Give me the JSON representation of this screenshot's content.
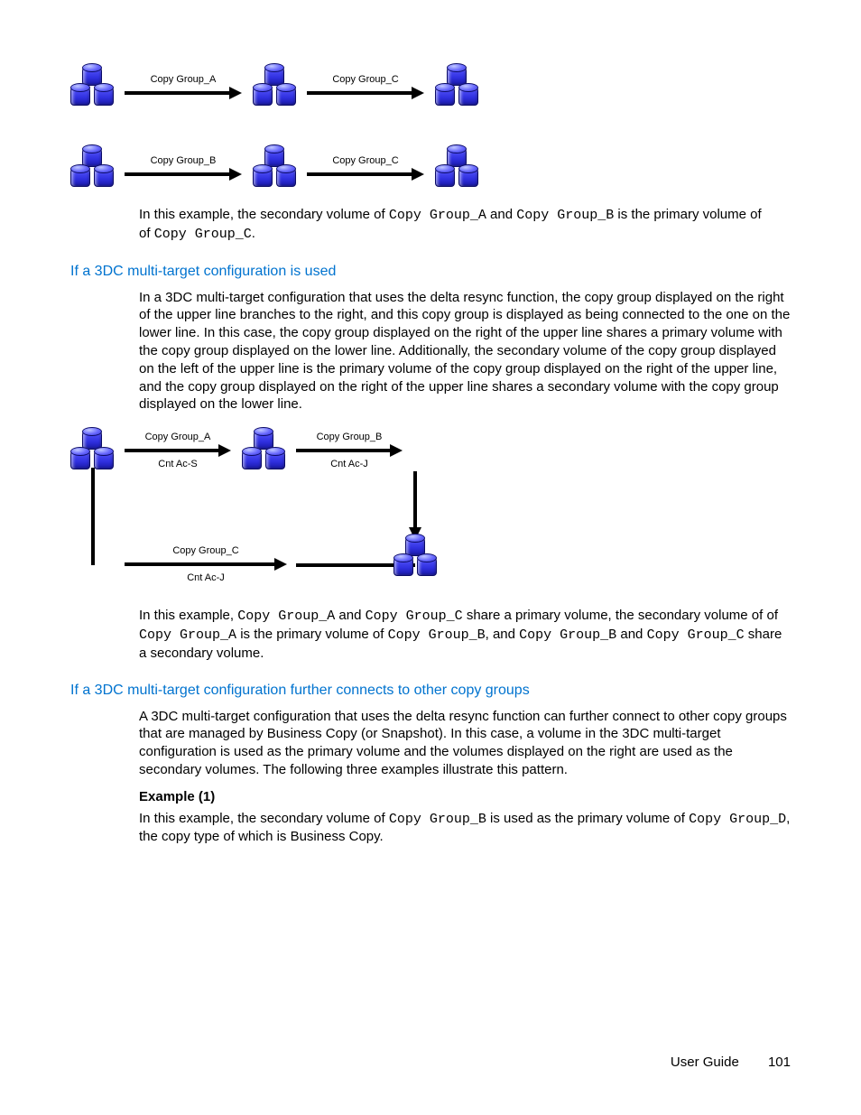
{
  "diagram1": {
    "row1": {
      "a_label": "Copy Group_A",
      "b_label": "Copy Group_C"
    },
    "row2": {
      "a_label": "Copy Group_B",
      "b_label": "Copy Group_C"
    }
  },
  "para1_a": "In this example, the secondary volume of ",
  "para1_ref1": "Copy Group_A",
  "para1_b": " and ",
  "para1_ref2": "Copy Group_B",
  "para1_c": " is the primary volume of ",
  "para1_ref3": "Copy Group_C",
  "para1_d": ".",
  "h_3dc": "If a 3DC multi-target configuration is used",
  "para2": "In a 3DC multi-target configuration that uses the delta resync function, the copy group displayed on the right of the upper line branches to the right, and this copy group is displayed as being connected to the one on the lower line. In this case, the copy group displayed on the right of the upper line shares a primary volume with the copy group displayed on the lower line. Additionally, the secondary volume of the copy group displayed on the left of the upper line is the primary volume of the copy group displayed on the right of the upper line, and the copy group displayed on the right of the upper line shares a secondary volume with the copy group displayed on the lower line.",
  "diagram2": {
    "top_a_label": "Copy Group_A",
    "top_a_sub": "Cnt Ac-S",
    "top_b_label": "Copy Group_B",
    "top_b_sub": "Cnt Ac-J",
    "bot_label": "Copy Group_C",
    "bot_sub": "Cnt Ac-J"
  },
  "para3_a": "In this example, ",
  "para3_ref1": "Copy Group_A",
  "para3_b": " and ",
  "para3_ref2": "Copy Group_C",
  "para3_c": " share a primary volume, the secondary volume of ",
  "para3_ref3": "Copy Group_A",
  "para3_d": " is the primary volume of ",
  "para3_ref4": "Copy Group_B",
  "para3_e": ", and ",
  "para3_ref5": "Copy Group_B",
  "para3_f": " and ",
  "para3_ref6": "Copy Group_C",
  "para3_g": " share a secondary volume.",
  "h_3dc2": "If a 3DC multi-target configuration further connects to other copy groups",
  "para4": "A 3DC multi-target configuration that uses the delta resync function can further connect to other copy groups that are managed by Business Copy (or Snapshot). In this case, a volume in the 3DC multi-target configuration is used as the primary volume and the volumes displayed on the right are used as the secondary volumes. The following three examples illustrate this pattern.",
  "ex1_h": "Example (1)",
  "para5_a": "In this example, the secondary volume of ",
  "para5_ref1": "Copy Group_B",
  "para5_b": " is used as the primary volume of ",
  "para5_ref2": "Copy Group_D",
  "para5_c": ", the copy type of which is Business Copy.",
  "footer_label": "User Guide",
  "footer_page": "101"
}
